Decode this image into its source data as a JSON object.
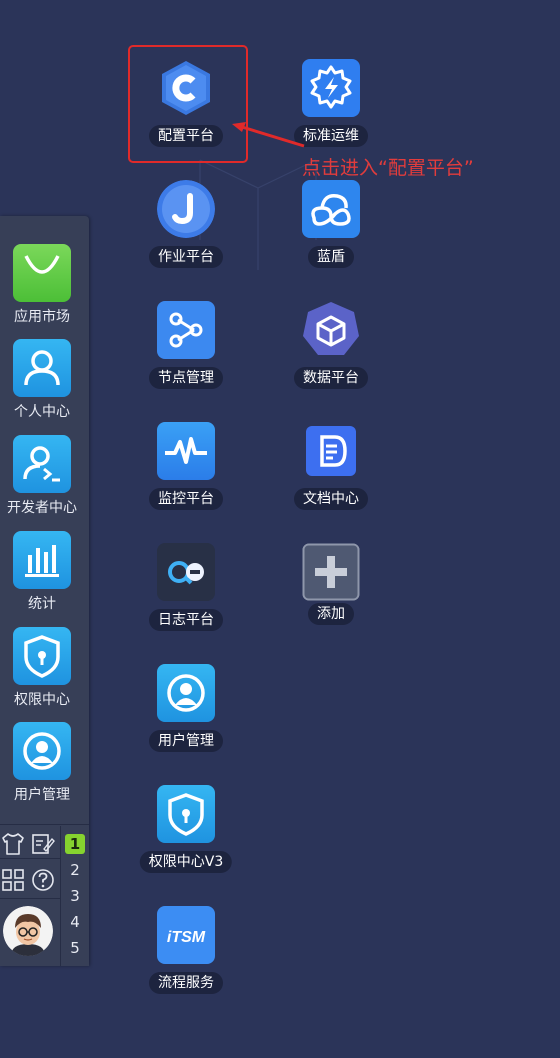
{
  "annotation": {
    "text": "点击进入“配置平台”"
  },
  "apps": [
    {
      "label": "配置平台",
      "icon": "config-platform-icon"
    },
    {
      "label": "标准运维",
      "icon": "standard-ops-icon"
    },
    {
      "label": "作业平台",
      "icon": "job-platform-icon"
    },
    {
      "label": "蓝盾",
      "icon": "bluedun-icon"
    },
    {
      "label": "节点管理",
      "icon": "node-management-icon"
    },
    {
      "label": "数据平台",
      "icon": "data-platform-icon"
    },
    {
      "label": "监控平台",
      "icon": "monitor-platform-icon"
    },
    {
      "label": "文档中心",
      "icon": "document-center-icon"
    },
    {
      "label": "日志平台",
      "icon": "log-platform-icon"
    },
    {
      "label": "添加",
      "icon": "add-icon"
    },
    {
      "label": "用户管理",
      "icon": "user-management-icon"
    },
    {
      "label": "权限中心V3",
      "icon": "permission-center-icon"
    },
    {
      "label": "流程服务",
      "icon": "itsm-icon",
      "icon_text": "iTSM"
    }
  ],
  "dock": {
    "items": [
      {
        "label": "应用市场",
        "icon": "app-market-icon"
      },
      {
        "label": "个人中心",
        "icon": "personal-center-icon"
      },
      {
        "label": "开发者中心",
        "icon": "developer-center-icon"
      },
      {
        "label": "统计",
        "icon": "statistics-icon"
      },
      {
        "label": "权限中心",
        "icon": "permission-center-icon"
      },
      {
        "label": "用户管理",
        "icon": "user-management-icon"
      }
    ],
    "tools": [
      "shirt-icon",
      "edit-icon",
      "grid-icon",
      "help-icon"
    ],
    "desktop_numbers": [
      "1",
      "2",
      "3",
      "4",
      "5"
    ],
    "active_desktop": "1"
  }
}
